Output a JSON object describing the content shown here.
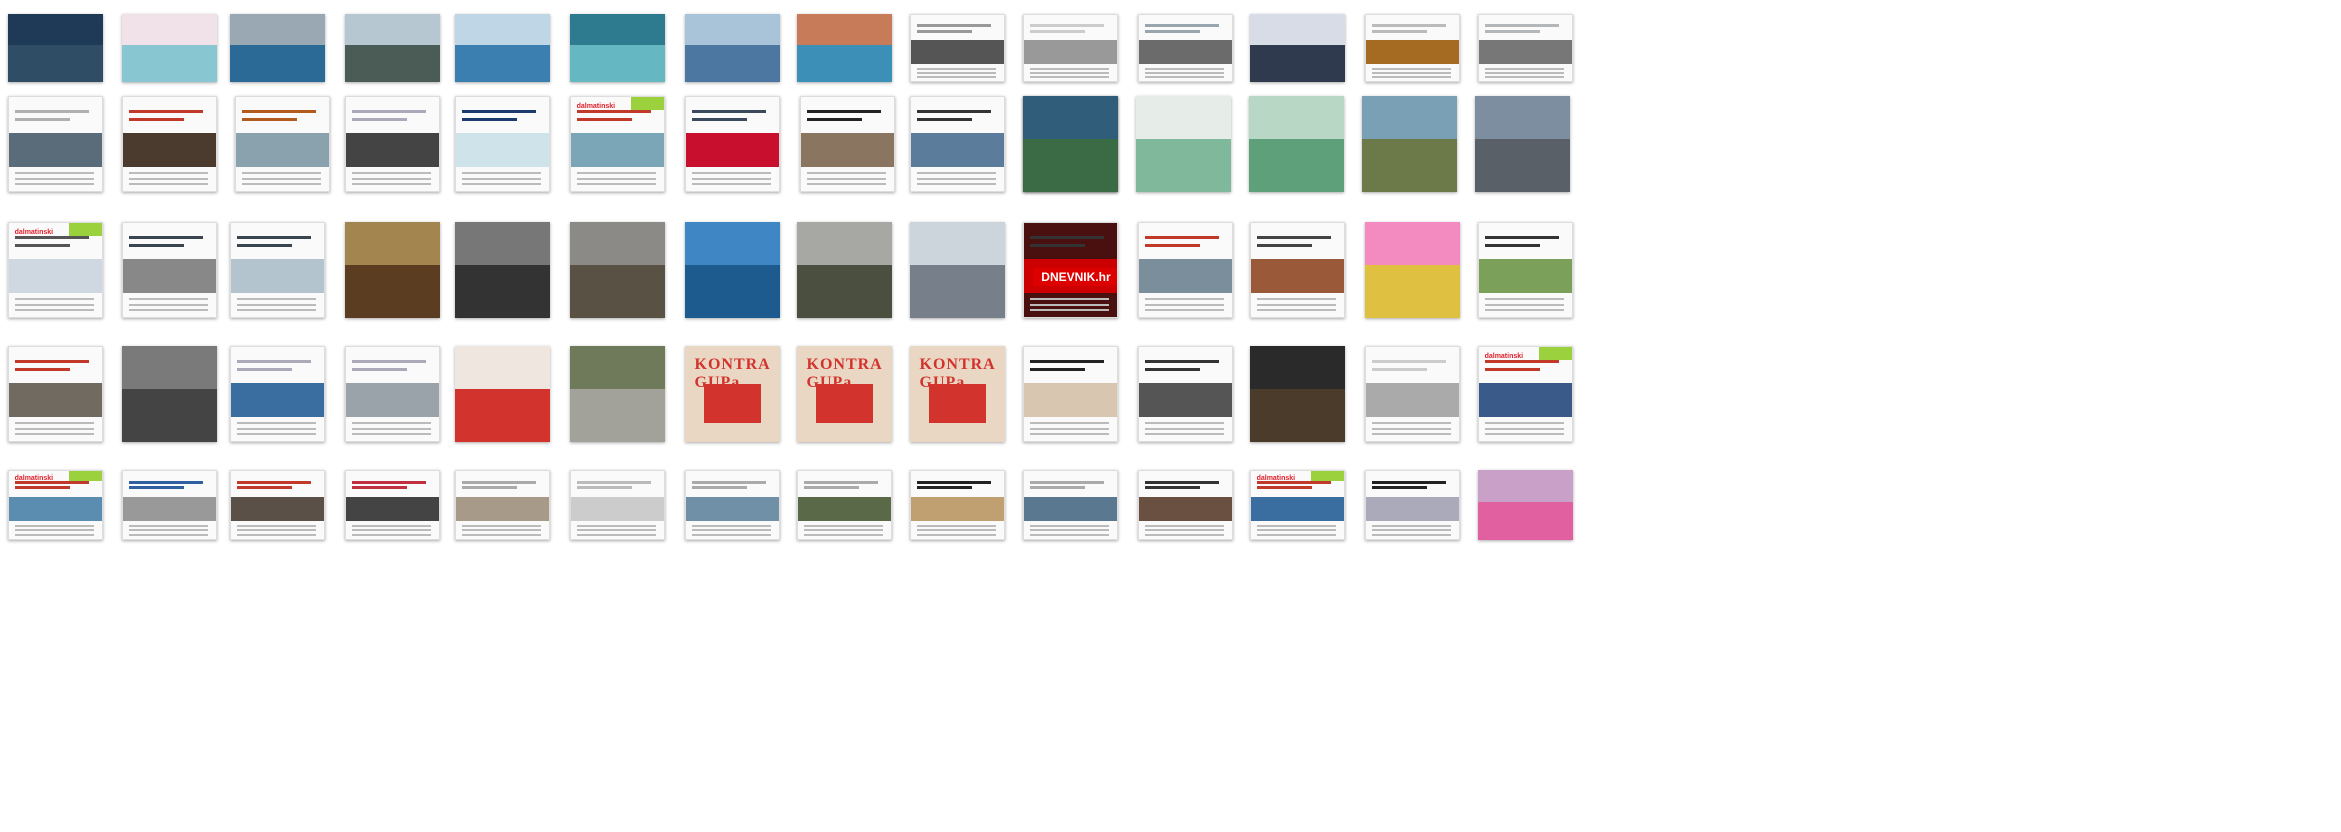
{
  "title": "",
  "rows": [
    [
      {
        "kind": "map",
        "a": "#1e3a56",
        "b": "#2f4e66"
      },
      {
        "kind": "map",
        "a": "#f0e2e8",
        "b": "#88c6d2"
      },
      {
        "kind": "photo",
        "a": "#9aa8b3",
        "b": "#2b6a96"
      },
      {
        "kind": "photo",
        "a": "#b7c7d2",
        "b": "#4b5b55"
      },
      {
        "kind": "photo",
        "a": "#bfd6e6",
        "b": "#3b7fb0"
      },
      {
        "kind": "photo",
        "a": "#2e7a8f",
        "b": "#65b7c2"
      },
      {
        "kind": "photo",
        "a": "#a9c4d9",
        "b": "#4c77a0"
      },
      {
        "kind": "photo",
        "a": "#c77b58",
        "b": "#3c8fb7"
      },
      {
        "kind": "doc",
        "a": "#555",
        "b": "#999"
      },
      {
        "kind": "doc",
        "a": "#999",
        "b": "#ccc"
      },
      {
        "kind": "doc",
        "a": "#6b6b6b",
        "b": "#9aa6ae"
      },
      {
        "kind": "photo",
        "a": "#d8dce6",
        "b": "#303a4e"
      },
      {
        "kind": "doc",
        "a": "#a66b22",
        "b": "#bbb"
      },
      {
        "kind": "doc",
        "a": "#777",
        "b": "#b3b7ba"
      }
    ],
    [
      {
        "kind": "doc",
        "a": "#5a6b7a",
        "b": "#b0b0b0"
      },
      {
        "kind": "doc",
        "a": "#4a3b2e",
        "b": "#c0392b"
      },
      {
        "kind": "doc",
        "a": "#8aa2ad",
        "b": "#b35a1f"
      },
      {
        "kind": "doc",
        "a": "#444",
        "b": "#aab"
      },
      {
        "kind": "doc",
        "a": "#cfe4ea",
        "b": "#1c3b6d"
      },
      {
        "kind": "doc",
        "a": "#7aa6b8",
        "b": "#c0392b"
      },
      {
        "kind": "doc",
        "a": "#c8102e",
        "b": "#3a4a5c"
      },
      {
        "kind": "doc",
        "a": "#8a7660",
        "b": "#222"
      },
      {
        "kind": "doc",
        "a": "#5b7c9a",
        "b": "#333"
      },
      {
        "kind": "doc",
        "a": "#aaa",
        "b": "#444"
      },
      {
        "kind": "map",
        "a": "#2f5d7a",
        "b": "#3a6b45"
      },
      {
        "kind": "map",
        "a": "#e6ede9",
        "b": "#7fb89a"
      },
      {
        "kind": "map",
        "a": "#b8d8c5",
        "b": "#5da07a"
      },
      {
        "kind": "photo",
        "a": "#7aa0b5",
        "b": "#6c7a4a"
      },
      {
        "kind": "photo",
        "a": "#7c8ea0",
        "b": "#5a6068"
      }
    ],
    [
      {
        "kind": "doc",
        "a": "#cfd8e0",
        "b": "#555"
      },
      {
        "kind": "doc",
        "a": "#888",
        "b": "#3a4550"
      },
      {
        "kind": "doc",
        "a": "#b3c4cf",
        "b": "#3a4550"
      },
      {
        "kind": "photo",
        "a": "#a3864f",
        "b": "#5b3e22"
      },
      {
        "kind": "photo",
        "a": "#777",
        "b": "#333"
      },
      {
        "kind": "photo",
        "a": "#8c8a86",
        "b": "#5a5145"
      },
      {
        "kind": "photo",
        "a": "#3e86c4",
        "b": "#1d5a8e"
      },
      {
        "kind": "photo",
        "a": "#a7a8a4",
        "b": "#4a4f40"
      },
      {
        "kind": "photo",
        "a": "#cbd5db",
        "b": "#77808a"
      },
      {
        "kind": "dnevnik",
        "a": "#c00",
        "b": "#333"
      },
      {
        "kind": "doc",
        "a": "#7b8e9c",
        "b": "#c0392b"
      },
      {
        "kind": "doc",
        "a": "#9a5a3a",
        "b": "#444"
      },
      {
        "kind": "map",
        "a": "#f38bc0",
        "b": "#e0c040"
      },
      {
        "kind": "doc",
        "a": "#7aa05a",
        "b": "#333"
      }
    ],
    [
      {
        "kind": "doc",
        "a": "#706a60",
        "b": "#c0392b"
      },
      {
        "kind": "photo",
        "a": "#7a7a7a",
        "b": "#444"
      },
      {
        "kind": "doc",
        "a": "#3a6ea0",
        "b": "#aab"
      },
      {
        "kind": "doc",
        "a": "#9ba3aa",
        "b": "#aab"
      },
      {
        "kind": "map",
        "a": "#f0e6e0",
        "b": "#d2332d"
      },
      {
        "kind": "photo",
        "a": "#6e7a5a",
        "b": "#a2a29a"
      },
      {
        "kind": "poster",
        "a": "#e9d7c4",
        "b": "#d2332d"
      },
      {
        "kind": "poster",
        "a": "#e9d7c4",
        "b": "#d2332d"
      },
      {
        "kind": "poster",
        "a": "#e9d7c4",
        "b": "#d2332d"
      },
      {
        "kind": "doc",
        "a": "#d9c6b0",
        "b": "#222"
      },
      {
        "kind": "doc",
        "a": "#555",
        "b": "#333"
      },
      {
        "kind": "photo",
        "a": "#2a2a2a",
        "b": "#4a3b2a"
      },
      {
        "kind": "doc",
        "a": "#aaa",
        "b": "#ccc"
      },
      {
        "kind": "doc",
        "a": "#3a5b8a",
        "b": "#c0392b"
      }
    ],
    [
      {
        "kind": "doc",
        "a": "#5b8db0",
        "b": "#c0392b"
      },
      {
        "kind": "doc",
        "a": "#999",
        "b": "#3060a0"
      },
      {
        "kind": "doc",
        "a": "#5a5048",
        "b": "#c0392b"
      },
      {
        "kind": "doc",
        "a": "#444",
        "b": "#c03040"
      },
      {
        "kind": "doc",
        "a": "#a89a88",
        "b": "#aaa"
      },
      {
        "kind": "doc",
        "a": "#ccc",
        "b": "#bbb"
      },
      {
        "kind": "doc",
        "a": "#7090a8",
        "b": "#aaa"
      },
      {
        "kind": "doc",
        "a": "#5a6a48",
        "b": "#aaa"
      },
      {
        "kind": "doc",
        "a": "#c0a070",
        "b": "#222"
      },
      {
        "kind": "doc",
        "a": "#5a7890",
        "b": "#aaa"
      },
      {
        "kind": "doc",
        "a": "#6a5040",
        "b": "#333"
      },
      {
        "kind": "doc",
        "a": "#3a6ea0",
        "b": "#c0392b"
      },
      {
        "kind": "doc",
        "a": "#aab",
        "b": "#222"
      },
      {
        "kind": "map",
        "a": "#c8a0c8",
        "b": "#e060a0"
      }
    ]
  ],
  "texts": {
    "r0c8": "",
    "r1c0": "",
    "r2c9_brand": "DNEVNIK.hr",
    "r3c6_title": "KONTRA GUPa",
    "r3c7_title": "KONTRA GUPa",
    "r3c8_title": "KONTRA GUPa",
    "r2c0_brand": "dalmatinski",
    "r1c5_brand": "dalmatinski",
    "r3c13_brand": "dalmatinski",
    "r4c0_brand": "dalmatinski",
    "r4c11_brand": "dalmatinski"
  }
}
